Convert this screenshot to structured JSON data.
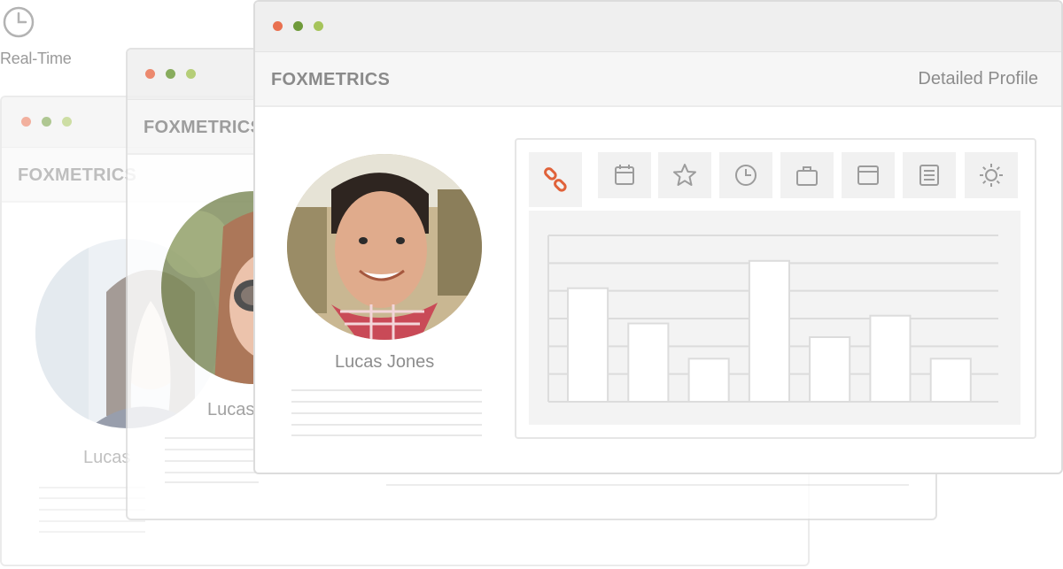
{
  "badge": {
    "label": "Real-Time",
    "icon": "clock-icon"
  },
  "brand": "FOXMETRICS",
  "main_window": {
    "tab_label": "Detailed Profile",
    "profile_name": "Lucas Jones",
    "tabs": [
      {
        "icon": "link-icon",
        "active": true
      },
      {
        "icon": "calendar-icon",
        "active": false
      },
      {
        "icon": "star-icon",
        "active": false
      },
      {
        "icon": "clock-icon",
        "active": false
      },
      {
        "icon": "briefcase-icon",
        "active": false
      },
      {
        "icon": "browser-window-icon",
        "active": false
      },
      {
        "icon": "document-icon",
        "active": false
      },
      {
        "icon": "sun-icon",
        "active": false
      }
    ]
  },
  "middle_window": {
    "profile_name": "Lucas"
  },
  "back_window": {
    "profile_name": "Lucas"
  },
  "colors": {
    "accent": "#e0623a",
    "dot_red": "#e9704f",
    "dot_green_dark": "#6f9a3a",
    "dot_green_light": "#a6c45b"
  },
  "chart_data": {
    "type": "bar",
    "values": [
      5.8,
      4.0,
      2.2,
      7.2,
      3.3,
      4.4,
      2.2
    ],
    "ylim": [
      0,
      8.5
    ]
  }
}
